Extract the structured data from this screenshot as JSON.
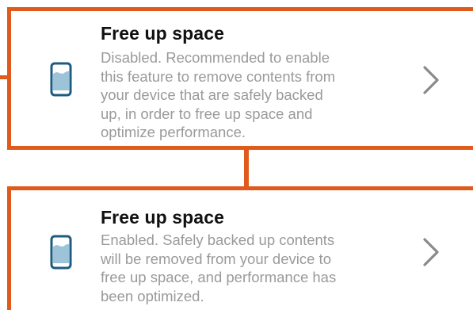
{
  "colors": {
    "accent": "#e05a1c",
    "icon": "#1d5b80",
    "icon_fill": "#9dc3d9",
    "title": "#111111",
    "description": "#9a9a9a",
    "chevron": "#8a8a8a"
  },
  "items": [
    {
      "title": "Free up space",
      "description_lines": [
        "Disabled. Recommended to enable",
        "this feature to remove contents from",
        "your device that are safely backed",
        "up, in order to free up space and",
        "optimize performance."
      ],
      "icon": "phone-storage-icon",
      "trailing_icon": "chevron-right-icon"
    },
    {
      "title": "Free up space",
      "description_lines": [
        "Enabled. Safely backed up contents",
        "will be removed from your device to",
        "free up space, and performance has",
        "been optimized."
      ],
      "icon": "phone-storage-icon",
      "trailing_icon": "chevron-right-icon"
    }
  ]
}
